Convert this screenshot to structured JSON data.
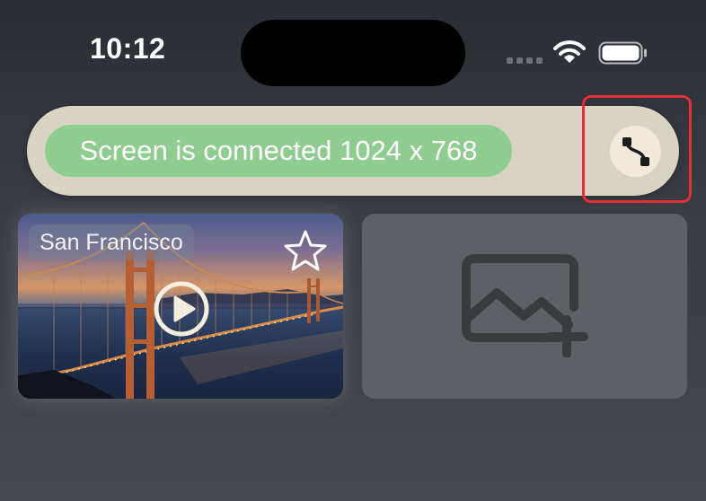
{
  "status_bar": {
    "time": "10:12"
  },
  "connection": {
    "status_text": "Screen is connected 1024 x 768",
    "button_icon": "route-icon",
    "colors": {
      "pill": "#d9d3c4",
      "status": "#8fcc8f",
      "highlight": "#e2303b"
    }
  },
  "cards": {
    "sf": {
      "title": "San Francisco",
      "favorite_icon": "star-icon",
      "play_icon": "play-icon"
    },
    "add": {
      "icon": "add-image-icon"
    }
  }
}
